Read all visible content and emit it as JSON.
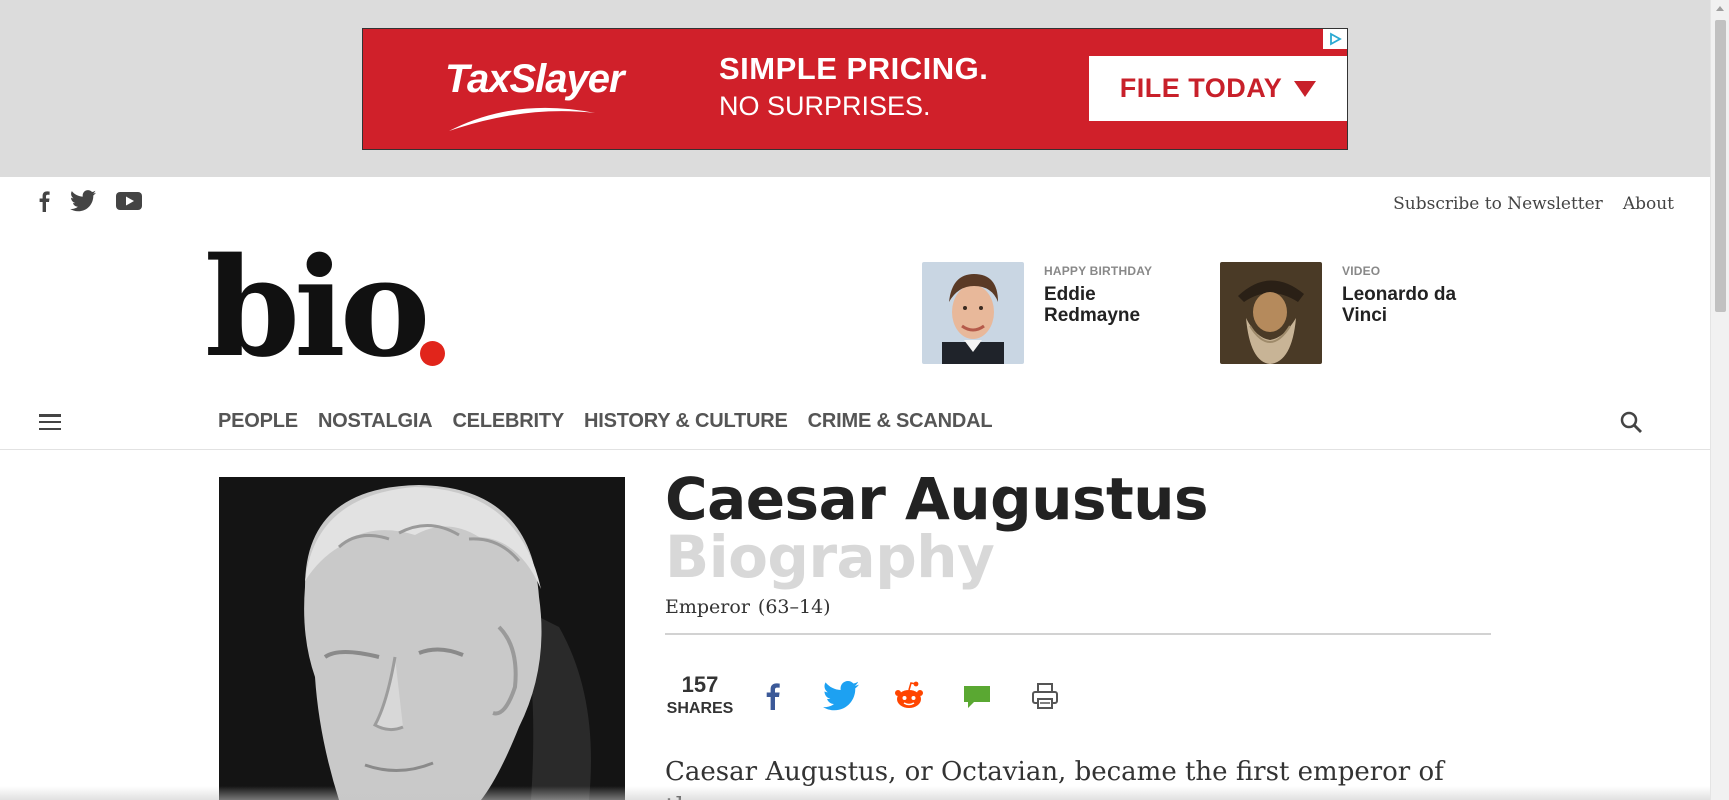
{
  "ad": {
    "brand": "TaxSlayer",
    "headline": "SIMPLE PRICING.",
    "subline": "NO SURPRISES.",
    "cta": "FILE TODAY"
  },
  "top_links": {
    "newsletter": "Subscribe to Newsletter",
    "about": "About"
  },
  "logo": {
    "text": "bio",
    "dot_color": "#e1251b"
  },
  "promos": [
    {
      "kicker": "HAPPY BIRTHDAY",
      "title": "Eddie Redmayne"
    },
    {
      "kicker": "VIDEO",
      "title": "Leonardo da Vinci"
    }
  ],
  "nav": {
    "items": [
      "PEOPLE",
      "NOSTALGIA",
      "CELEBRITY",
      "HISTORY & CULTURE",
      "CRIME & SCANDAL"
    ]
  },
  "article": {
    "title": "Caesar Augustus",
    "subtitle": "Biography",
    "role": "Emperor",
    "years": "(63–14)",
    "shares_count": "157",
    "shares_label": "SHARES",
    "intro": "Caesar Augustus, or Octavian, became the first emperor of the"
  },
  "colors": {
    "ad_red": "#d0202a",
    "facebook": "#3b5998",
    "twitter": "#1da1f2",
    "reddit": "#ff4500",
    "comment": "#5aa832"
  }
}
